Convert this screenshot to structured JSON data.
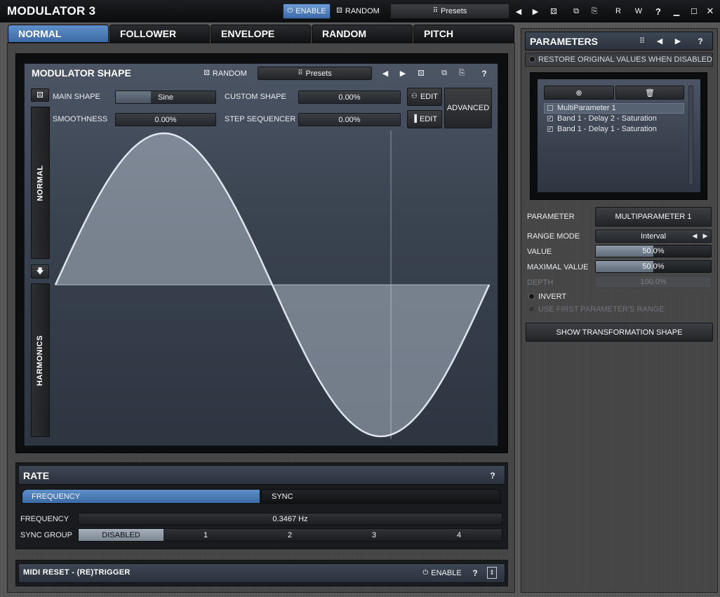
{
  "app": {
    "title": "MODULATOR 3"
  },
  "topbar": {
    "enable": "ENABLE",
    "random": "RANDOM",
    "presets": "Presets",
    "r": "R",
    "w": "W",
    "help": "?"
  },
  "tabs": [
    {
      "label": "NORMAL",
      "active": true
    },
    {
      "label": "FOLLOWER"
    },
    {
      "label": "ENVELOPE"
    },
    {
      "label": "RANDOM"
    },
    {
      "label": "PITCH"
    }
  ],
  "shape": {
    "title": "MODULATOR SHAPE",
    "random": "RANDOM",
    "presets": "Presets",
    "help": "?",
    "main_shape_label": "MAIN SHAPE",
    "main_shape_value": "Sine",
    "smoothness_label": "SMOOTHNESS",
    "smoothness_value": "0.00%",
    "custom_shape_label": "CUSTOM SHAPE",
    "custom_shape_value": "0.00%",
    "step_sequencer_label": "STEP SEQUENCER",
    "step_sequencer_value": "0.00%",
    "edit1": "EDIT",
    "edit2": "EDIT",
    "advanced": "ADVANCED",
    "normal_vertical": "NORMAL",
    "harmonics_vertical": "HARMONICS"
  },
  "rate": {
    "title": "RATE",
    "help": "?",
    "tab_frequency": "FREQUENCY",
    "tab_sync": "SYNC",
    "frequency_label": "FREQUENCY",
    "frequency_value": "0.3467 Hz",
    "sync_group_label": "SYNC GROUP",
    "sync_options": [
      "DISABLED",
      "1",
      "2",
      "3",
      "4"
    ]
  },
  "midi": {
    "title": "MIDI RESET - (RE)TRIGGER",
    "enable": "ENABLE",
    "help": "?"
  },
  "parameters": {
    "title": "PARAMETERS",
    "help": "?",
    "restore": "RESTORE ORIGINAL VALUES WHEN DISABLED",
    "list": [
      {
        "label": "MultiParameter 1",
        "checked": false
      },
      {
        "label": "Band 1 - Delay 2 - Saturation",
        "checked": true
      },
      {
        "label": "Band 1 - Delay 1 - Saturation",
        "checked": true
      }
    ],
    "parameter_label": "PARAMETER",
    "parameter_value": "MULTIPARAMETER 1",
    "range_mode_label": "RANGE MODE",
    "range_mode_value": "Interval",
    "value_label": "VALUE",
    "value_value": "50.0%",
    "maximal_label": "MAXIMAL VALUE",
    "maximal_value": "50.0%",
    "depth_label": "DEPTH",
    "depth_value": "100.0%",
    "invert": "INVERT",
    "use_first": "USE FIRST PARAMETER'S RANGE",
    "show_transformation": "SHOW TRANSFORMATION SHAPE"
  },
  "levels": {
    "value": 0.5,
    "maximal": 0.5
  }
}
